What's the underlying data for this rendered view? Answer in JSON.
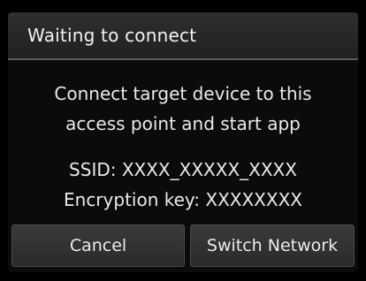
{
  "dialog": {
    "title": "Waiting to connect",
    "message_line1": "Connect target device to this",
    "message_line2": "access point and start app",
    "ssid_line": "SSID: XXXX_XXXXX_XXXX",
    "encryption_line": "Encryption key: XXXXXXXX"
  },
  "buttons": {
    "cancel_label": "Cancel",
    "switch_network_label": "Switch Network"
  }
}
